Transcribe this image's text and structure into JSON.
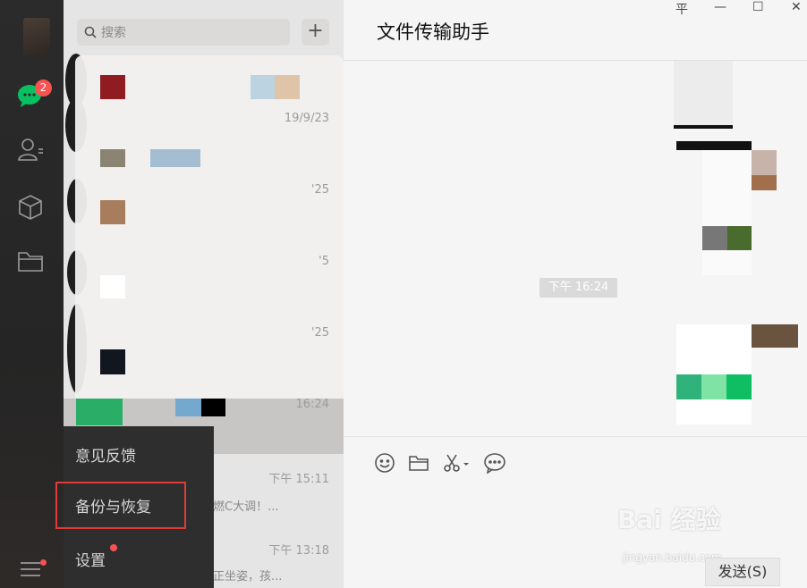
{
  "search": {
    "placeholder": "搜索"
  },
  "nav": {
    "unread_badge": "2"
  },
  "chat_list": {
    "times": [
      "19/9/23",
      "'25",
      "'5",
      "'25",
      "16:24",
      "下午 15:11",
      "下午 13:18"
    ],
    "snippets": [
      "燃C大调！...",
      "正坐姿，孩..."
    ]
  },
  "popup_menu": {
    "items": [
      "意见反馈",
      "备份与恢复",
      "设置"
    ]
  },
  "chat": {
    "title": "文件传输助手",
    "timestamp": "下午 16:24",
    "send_label": "发送(S)"
  },
  "window": {
    "pin": "平",
    "minimize": "—",
    "maximize": "☐",
    "close": "✕"
  },
  "watermark": {
    "main": "Bai 经验",
    "sub": "jingyan.baidu.com"
  }
}
